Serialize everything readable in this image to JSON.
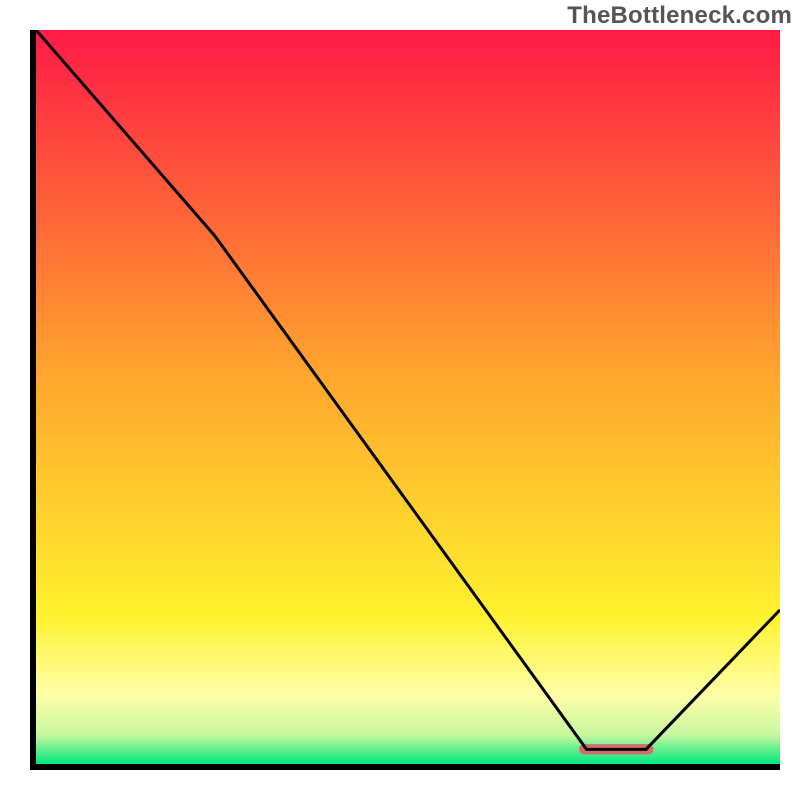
{
  "watermark": "TheBottleneck.com",
  "chart_data": {
    "type": "line",
    "title": "",
    "xlabel": "",
    "ylabel": "",
    "xlim": [
      0,
      100
    ],
    "ylim": [
      0,
      100
    ],
    "grid": false,
    "legend": false,
    "series": [
      {
        "name": "curve",
        "x": [
          0,
          24,
          74,
          82,
          100
        ],
        "values": [
          100,
          72,
          2,
          2,
          21
        ],
        "stroke": "#000000",
        "stroke_width": 0.5
      }
    ],
    "marker": {
      "name": "optimal-range",
      "x_start": 73,
      "x_end": 83,
      "y": 2,
      "color": "#d36d6d"
    },
    "background_gradient": {
      "type": "vertical",
      "stops": [
        {
          "offset": 0.0,
          "color": "#ff1a46"
        },
        {
          "offset": 0.46,
          "color": "#ffa32e"
        },
        {
          "offset": 0.8,
          "color": "#fff22e"
        },
        {
          "offset": 0.905,
          "color": "#ffffa8"
        },
        {
          "offset": 0.96,
          "color": "#c8f7a0"
        },
        {
          "offset": 1.0,
          "color": "#00e87e"
        }
      ]
    }
  }
}
